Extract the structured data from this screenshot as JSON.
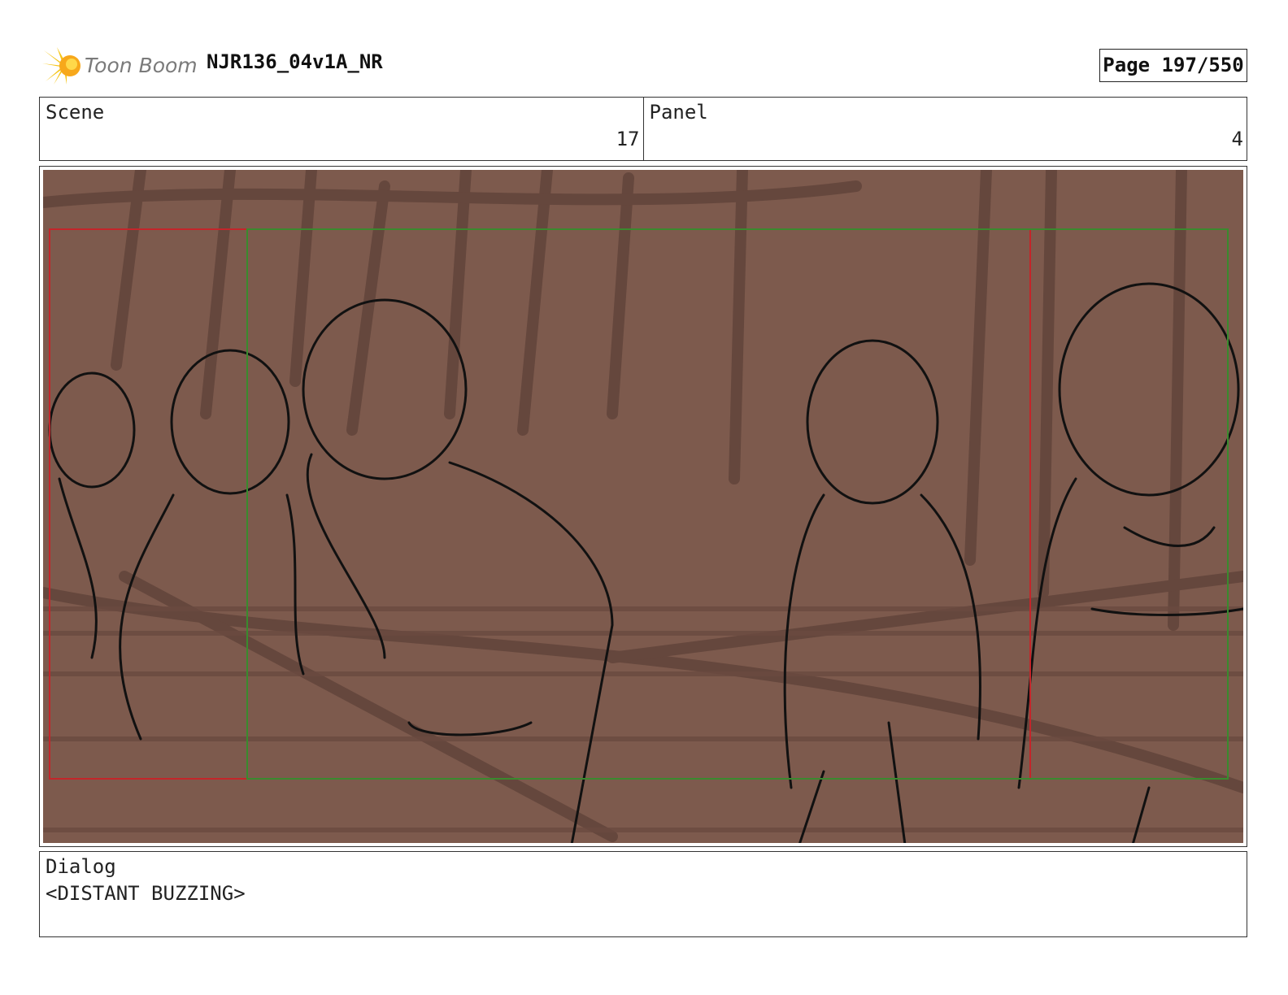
{
  "header": {
    "logo_text": "Toon Boom",
    "project_title": "NJR136_04v1A_NR",
    "page_label": "Page 197/550",
    "logo_color": "#f5c518"
  },
  "info": {
    "scene_label": "Scene",
    "scene_value": "17",
    "panel_label": "Panel",
    "panel_value": "4"
  },
  "panel": {
    "description_icon": "storyboard-sketch-image",
    "background_color": "#7d5a4d",
    "safe_frame_color": "#c4252a",
    "title_frame_color": "#3a8a2e"
  },
  "dialog": {
    "label": "Dialog",
    "text": "<DISTANT BUZZING>"
  }
}
